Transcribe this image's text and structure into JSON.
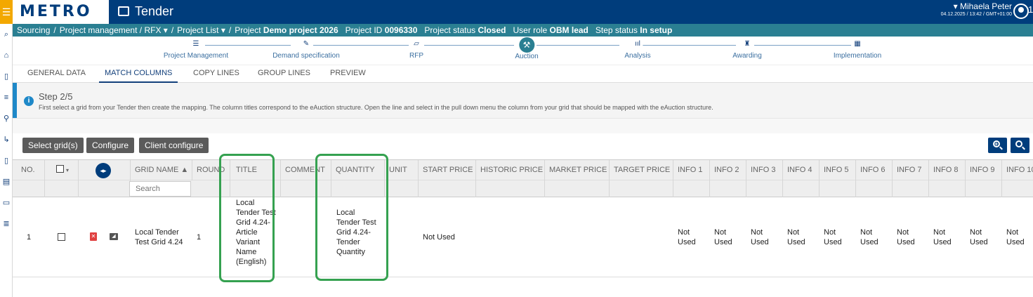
{
  "header": {
    "logo": "METRO",
    "app_title": "Tender",
    "user_name": "Mihaela Peter",
    "user_time": "04.12.2025 / 13:42 / GMT+01:00",
    "extra": "1"
  },
  "breadcrumb": {
    "sourcing": "Sourcing",
    "project_mgmt": "Project management / RFX ▾",
    "project_list": "Project List ▾",
    "project_label": "Project",
    "project_value": "Demo project 2026",
    "project_id_label": "Project ID",
    "project_id_value": "0096330",
    "status_label": "Project status",
    "status_value": "Closed",
    "role_label": "User role",
    "role_value": "OBM lead",
    "step_status_label": "Step status",
    "step_status_value": "In setup"
  },
  "stepper": {
    "steps": [
      {
        "label": "Project Management",
        "icon": "list-icon"
      },
      {
        "label": "Demand specification",
        "icon": "pen-icon"
      },
      {
        "label": "RFP",
        "icon": "document-icon"
      },
      {
        "label": "Auction",
        "icon": "gavel-icon",
        "active": true
      },
      {
        "label": "Analysis",
        "icon": "bar-chart-icon"
      },
      {
        "label": "Awarding",
        "icon": "award-icon"
      },
      {
        "label": "Implementation",
        "icon": "calendar-icon"
      }
    ]
  },
  "tabs": [
    "GENERAL DATA",
    "MATCH COLUMNS",
    "COPY LINES",
    "GROUP LINES",
    "PREVIEW"
  ],
  "info": {
    "title": "Step 2/5",
    "text": "First select a grid from your Tender then create the mapping. The column titles correspond to the eAuction structure. Open the line and select in the pull down menu the column from your grid that should be mapped with the eAuction structure."
  },
  "toolbar": {
    "select_grids": "Select grid(s)",
    "configure": "Configure",
    "client_configure": "Client configure"
  },
  "grid": {
    "columns": [
      "NO.",
      "GRID NAME ▲",
      "ROUND",
      "TITLE",
      "COMMENT",
      "QUANTITY",
      "UNIT",
      "START PRICE",
      "HISTORIC PRICE",
      "MARKET PRICE",
      "TARGET PRICE",
      "INFO 1",
      "INFO 2",
      "INFO 3",
      "INFO 4",
      "INFO 5",
      "INFO 6",
      "INFO 7",
      "INFO 8",
      "INFO 9",
      "INFO 10"
    ],
    "search_placeholder": "Search",
    "row": {
      "no": "1",
      "grid_name": "Local Tender Test Grid 4.24",
      "round": "1",
      "title": "Local Tender Test Grid 4.24-Article Variant Name (English)",
      "quantity": "Local Tender Test Grid 4.24-Tender Quantity",
      "start_price": "Not Used",
      "info_values": [
        "Not Used",
        "Not Used",
        "Not Used",
        "Not Used",
        "Not Used",
        "Not Used",
        "Not Used",
        "Not Used",
        "Not Used",
        "Not Used"
      ]
    }
  },
  "colors": {
    "header_bg": "#003d7c",
    "breadcrumb_bg": "#2a7f92",
    "highlight": "#35a150",
    "info_accent": "#1e88c8"
  }
}
